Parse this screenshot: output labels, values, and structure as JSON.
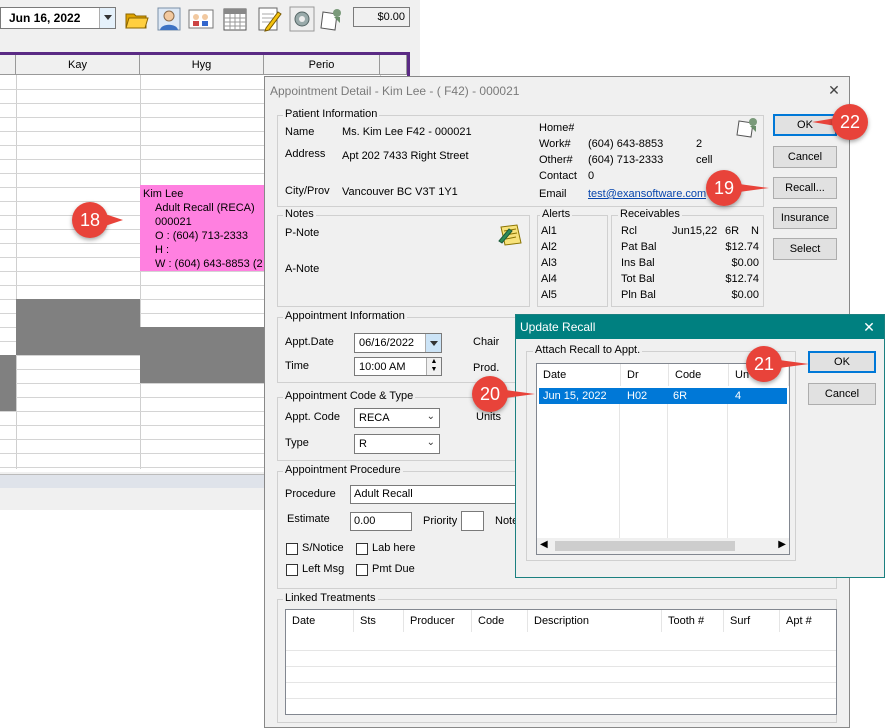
{
  "toolbar": {
    "date_value": "Jun 16, 2022",
    "balance": "$0.00",
    "icons": [
      "open-folder-icon",
      "patient-icon",
      "family-icon",
      "calendar-icon",
      "notepad-icon",
      "settings-icon",
      "recall-note-icon"
    ]
  },
  "scheduler": {
    "columns": [
      "Kay",
      "Hyg",
      "Perio"
    ],
    "appointment": {
      "lines": [
        "Kim Lee",
        "Adult Recall (RECA)",
        "000021",
        "O : (604) 713-2333",
        "H :",
        "W : (604) 643-8853 (2"
      ],
      "color": "#ff80e0"
    }
  },
  "appt_dialog": {
    "title": "Appointment Detail - Kim Lee - ( F42) - 000021",
    "patient": {
      "section_label": "Patient Information",
      "name_label": "Name",
      "name_value": "Ms. Kim Lee  F42 - 000021",
      "address_label": "Address",
      "address_value": "Apt 202 7433 Right Street",
      "city_label": "City/Prov",
      "city_value": "Vancouver BC V3T 1Y1",
      "home_label": "Home#",
      "work_label": "Work#",
      "work_value": "(604) 643-8853",
      "work_ext": "2",
      "other_label": "Other#",
      "other_value": "(604) 713-2333",
      "other_type": "cell",
      "contact_label": "Contact",
      "contact_value": "0",
      "email_label": "Email",
      "email_value": "test@exansoftware.com"
    },
    "buttons": {
      "ok": "OK",
      "cancel": "Cancel",
      "recall": "Recall...",
      "insurance": "Insurance",
      "select": "Select"
    },
    "notes": {
      "section_label": "Notes",
      "pnote_label": "P-Note",
      "anote_label": "A-Note"
    },
    "alerts": {
      "section_label": "Alerts",
      "items": [
        "Al1",
        "Al2",
        "Al3",
        "Al4",
        "Al5"
      ]
    },
    "receivables": {
      "section_label": "Receivables",
      "rcl_label": "Rcl",
      "rcl_date": "Jun15,22",
      "rcl_code": "6R",
      "rcl_flag": "N",
      "rows": [
        {
          "label": "Pat Bal",
          "value": "$12.74"
        },
        {
          "label": "Ins Bal",
          "value": "$0.00"
        },
        {
          "label": "Tot Bal",
          "value": "$12.74"
        },
        {
          "label": "Pln Bal",
          "value": "$0.00"
        }
      ]
    },
    "appt_info": {
      "section_label": "Appointment Information",
      "date_label": "Appt.Date",
      "date_value": "06/16/2022",
      "time_label": "Time",
      "time_value": "10:00 AM",
      "chair_label": "Chair",
      "prod_label": "Prod."
    },
    "appt_code": {
      "section_label": "Appointment Code & Type",
      "code_label": "Appt. Code",
      "code_value": "RECA",
      "type_label": "Type",
      "type_value": "R",
      "units_label": "Units"
    },
    "procedure": {
      "section_label": "Appointment Procedure",
      "procedure_label": "Procedure",
      "procedure_value": "Adult Recall",
      "estimate_label": "Estimate",
      "estimate_value": "0.00",
      "priority_label": "Priority",
      "note_label": "Note",
      "snotice_label": "S/Notice",
      "labhere_label": "Lab here",
      "leftmsg_label": "Left Msg",
      "pmtdue_label": "Pmt Due"
    },
    "linked": {
      "section_label": "Linked Treatments",
      "columns": [
        "Date",
        "Sts",
        "Producer",
        "Code",
        "Description",
        "Tooth #",
        "Surf",
        "Apt #"
      ]
    }
  },
  "recall_dialog": {
    "title": "Update Recall",
    "group_label": "Attach Recall to Appt.",
    "columns": [
      "Date",
      "Dr",
      "Code",
      "Un"
    ],
    "rows": [
      {
        "date": "Jun 15, 2022",
        "dr": "H02",
        "code": "6R",
        "units": "4"
      }
    ],
    "ok": "OK",
    "cancel": "Cancel",
    "selection_color": "#0078d7"
  },
  "callouts": [
    "18",
    "19",
    "20",
    "21",
    "22"
  ],
  "accent_color": "#e8433a"
}
